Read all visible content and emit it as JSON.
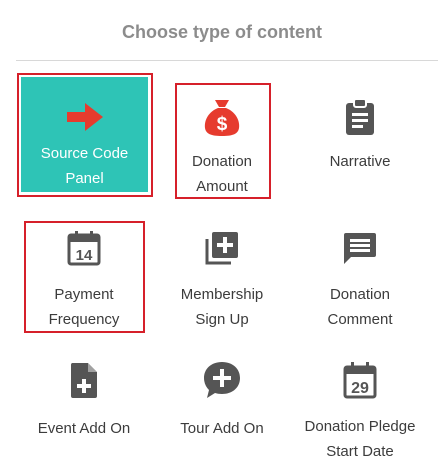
{
  "header": {
    "title": "Choose type of content"
  },
  "colors": {
    "selected_bg": "#2ec4b6",
    "highlight": "#d6202a",
    "icon_gray": "#555555",
    "arrow": "#e63b2e"
  },
  "tiles": [
    {
      "line1": "Source Code",
      "line2": "Panel",
      "icon": "arrow-right-icon"
    },
    {
      "line1": "Donation",
      "line2": "Amount",
      "icon": "money-bag-icon"
    },
    {
      "line1": "Narrative",
      "line2": "",
      "icon": "clipboard-icon"
    },
    {
      "line1": "Payment",
      "line2": "Frequency",
      "icon": "calendar-14-icon"
    },
    {
      "line1": "Membership",
      "line2": "Sign Up",
      "icon": "add-to-stack-icon"
    },
    {
      "line1": "Donation",
      "line2": "Comment",
      "icon": "comment-icon"
    },
    {
      "line1": "Event Add On",
      "line2": "",
      "icon": "file-add-icon"
    },
    {
      "line1": "Tour Add On",
      "line2": "",
      "icon": "chat-add-icon"
    },
    {
      "line1": "Donation Pledge",
      "line2": "Start Date",
      "icon": "calendar-29-icon"
    }
  ],
  "calendar_numbers": {
    "payment": "14",
    "pledge": "29"
  }
}
